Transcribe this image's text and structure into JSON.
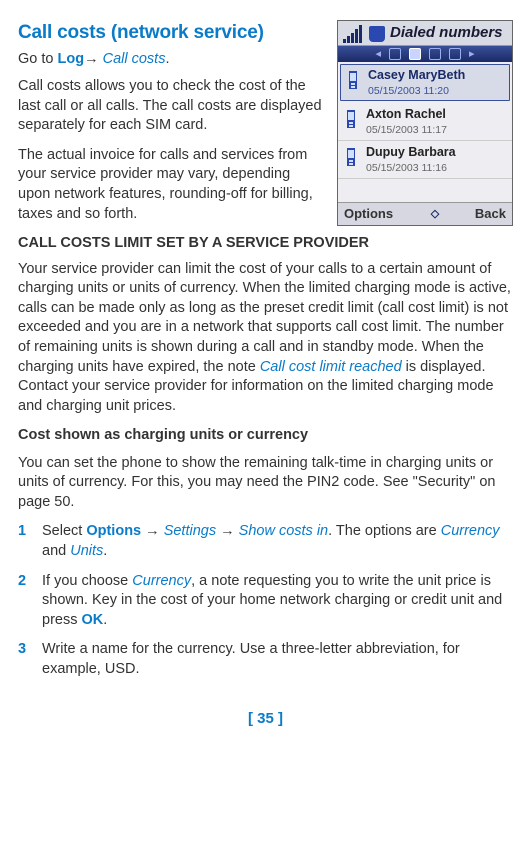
{
  "heading": "Call costs (network service)",
  "goto": {
    "prefix": "Go to ",
    "path1": "Log",
    "arrow": "→ ",
    "path2": "Call costs",
    "suffix": "."
  },
  "para1": "Call costs allows you to check the cost of the last call or all calls. The call costs are displayed separately for each SIM card.",
  "para2": "The actual invoice for calls and services from your service provider may vary, depending upon network features, rounding-off for billing, taxes and so forth.",
  "sectionTitle": "CALL COSTS LIMIT SET BY A SERVICE PROVIDER",
  "para3a": "Your service provider can limit the cost of your calls to a certain amount of charging units or units of currency. When the limited charging mode is active, calls can be made only as long as the preset credit limit (call cost limit) is not exceeded and you are in a network that supports call cost limit. The number of remaining units is shown during a call and in standby mode. When the charging units have expired, the note ",
  "para3b": "Call cost limit reached",
  "para3c": " is displayed. Contact your service provider for information on the limited charging mode and charging unit prices.",
  "subheading": "Cost shown as charging units or currency",
  "para4": "You can set the phone to show the remaining talk-time in charging units or units of currency. For this, you may need the PIN2 code. See \"Security\" on page 50.",
  "steps": [
    {
      "num": "1",
      "segs": [
        {
          "t": "Select ",
          "c": ""
        },
        {
          "t": "Options ",
          "c": "menu-path"
        },
        {
          "t": " → ",
          "c": ""
        },
        {
          "t": "Settings",
          "c": "menu-path-italic"
        },
        {
          "t": " → ",
          "c": ""
        },
        {
          "t": "Show costs in",
          "c": "menu-path-italic"
        },
        {
          "t": ". The options are ",
          "c": ""
        },
        {
          "t": "Currency",
          "c": "menu-path-italic"
        },
        {
          "t": " and ",
          "c": ""
        },
        {
          "t": "Units",
          "c": "menu-path-italic"
        },
        {
          "t": ".",
          "c": ""
        }
      ]
    },
    {
      "num": "2",
      "segs": [
        {
          "t": "If you choose ",
          "c": ""
        },
        {
          "t": "Currency",
          "c": "menu-path-italic"
        },
        {
          "t": ", a note requesting you to write the unit price is shown. Key in the cost of your home network charging or credit unit and press ",
          "c": ""
        },
        {
          "t": "OK",
          "c": "menu-path"
        },
        {
          "t": ".",
          "c": ""
        }
      ]
    },
    {
      "num": "3",
      "segs": [
        {
          "t": "Write a name for the currency. Use a three-letter abbreviation, for example, USD.",
          "c": ""
        }
      ]
    }
  ],
  "pageNum": "[ 35 ]",
  "phone": {
    "title": "Dialed numbers",
    "entries": [
      {
        "name": "Casey MaryBeth",
        "date": "05/15/2003  11:20",
        "sel": true
      },
      {
        "name": "Axton Rachel",
        "date": "05/15/2003  11:17",
        "sel": false
      },
      {
        "name": "Dupuy Barbara",
        "date": "05/15/2003  11:16",
        "sel": false
      }
    ],
    "softLeft": "Options",
    "softRight": "Back"
  }
}
